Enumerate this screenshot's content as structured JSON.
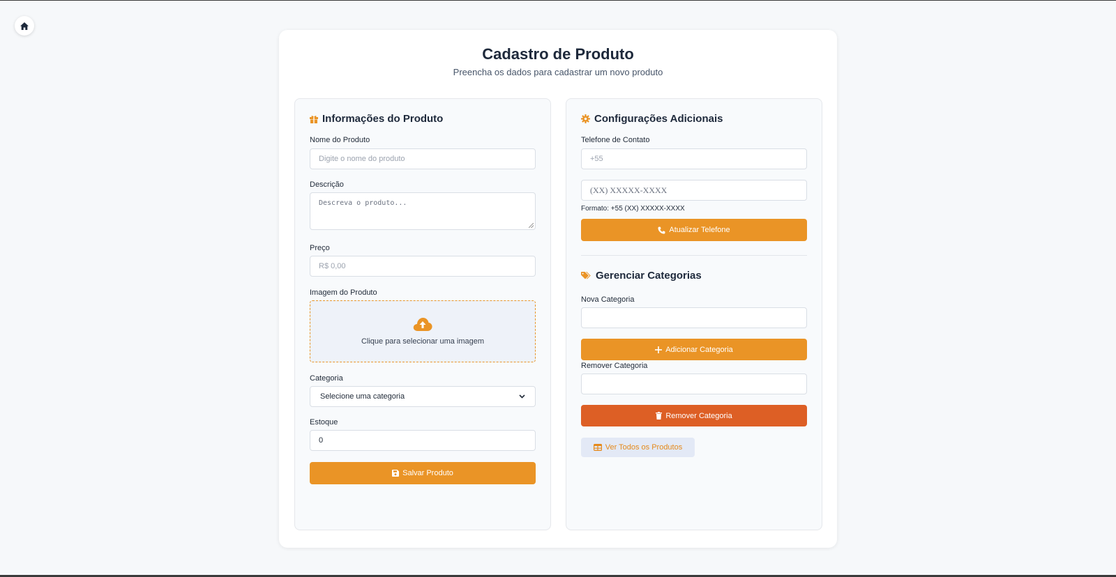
{
  "nav": {
    "home_icon": "home-icon"
  },
  "header": {
    "title": "Cadastro de Produto",
    "subtitle": "Preencha os dados para cadastrar um novo produto"
  },
  "product_panel": {
    "title": "Informações do Produto",
    "icon": "gift-icon",
    "name_label": "Nome do Produto",
    "name_placeholder": "Digite o nome do produto",
    "description_label": "Descrição",
    "description_placeholder": "Descreva o produto...",
    "price_label": "Preço",
    "price_placeholder": "R$ 0,00",
    "image_label": "Imagem do Produto",
    "image_upload_text": "Clique para selecionar uma imagem",
    "category_label": "Categoria",
    "category_selected": "Selecione uma categoria",
    "stock_label": "Estoque",
    "stock_value": "0",
    "save_button": "Salvar Produto"
  },
  "settings_panel": {
    "title": "Configurações Adicionais",
    "icon": "gear-icon",
    "phone_label": "Telefone de Contato",
    "country_code_value": "+55",
    "phone_placeholder": "(XX) XXXXX-XXXX",
    "phone_format_hint": "Formato: +55 (XX) XXXXX-XXXX",
    "update_phone_button": "Atualizar Telefone",
    "categories_title": "Gerenciar Categorias",
    "new_category_label": "Nova Categoria",
    "new_category_value": "",
    "add_category_button": "Adicionar Categoria",
    "remove_category_label": "Remover Categoria",
    "remove_category_value": "",
    "remove_category_button": "Remover Categoria",
    "view_all_button": "Ver Todos os Produtos"
  },
  "colors": {
    "accent": "#ea9426",
    "danger": "#dd5f25",
    "title": "#1e293b",
    "background": "#f6f8fa"
  }
}
